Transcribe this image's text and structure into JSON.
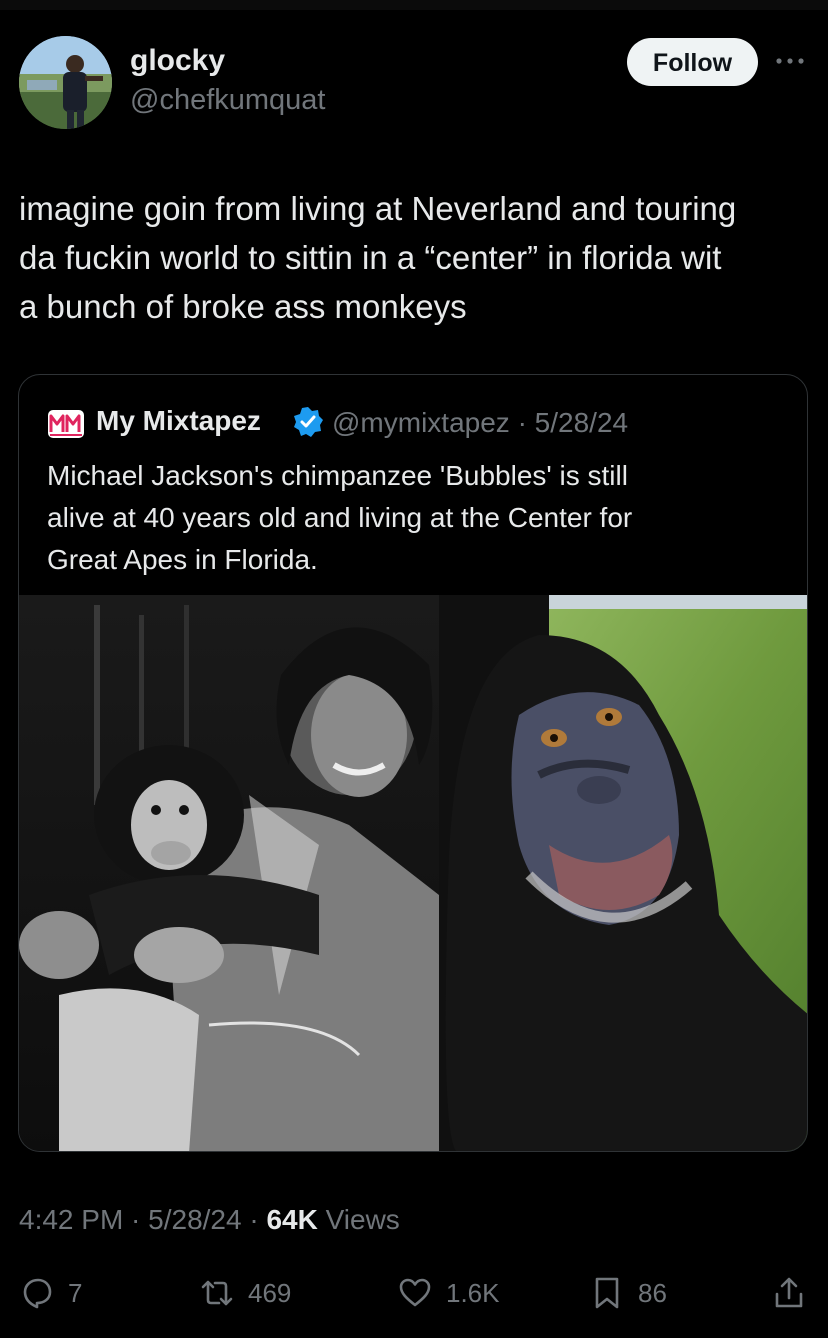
{
  "author": {
    "display_name": "glocky",
    "handle": "@chefkumquat",
    "follow_label": "Follow"
  },
  "tweet": {
    "text": "imagine goin from living at Neverland and touring\nda fuckin world to sittin in a “center” in florida wit\na bunch of broke ass monkeys"
  },
  "quote": {
    "logo_text": "MM",
    "display_name": "My Mixtapez",
    "verified": true,
    "meta": "@mymixtapez · 5/28/24",
    "text": "Michael Jackson's chimpanzee 'Bubbles' is still\nalive at 40 years old and living at the Center for\nGreat Apes in Florida.",
    "media_description_icons": [
      "photo-left-bw",
      "photo-right-color"
    ]
  },
  "meta": {
    "time_date": "4:42 PM · 5/28/24 · ",
    "views_count": "64K",
    "views_label": " Views"
  },
  "actions": {
    "replies": "7",
    "reposts": "469",
    "likes": "1.6K",
    "bookmarks": "86"
  },
  "colors": {
    "background": "#000000",
    "text": "#e7e9ea",
    "secondary": "#71767b",
    "border": "#2f3336",
    "verified": "#1d9bf0",
    "logo": "#e0245e"
  }
}
